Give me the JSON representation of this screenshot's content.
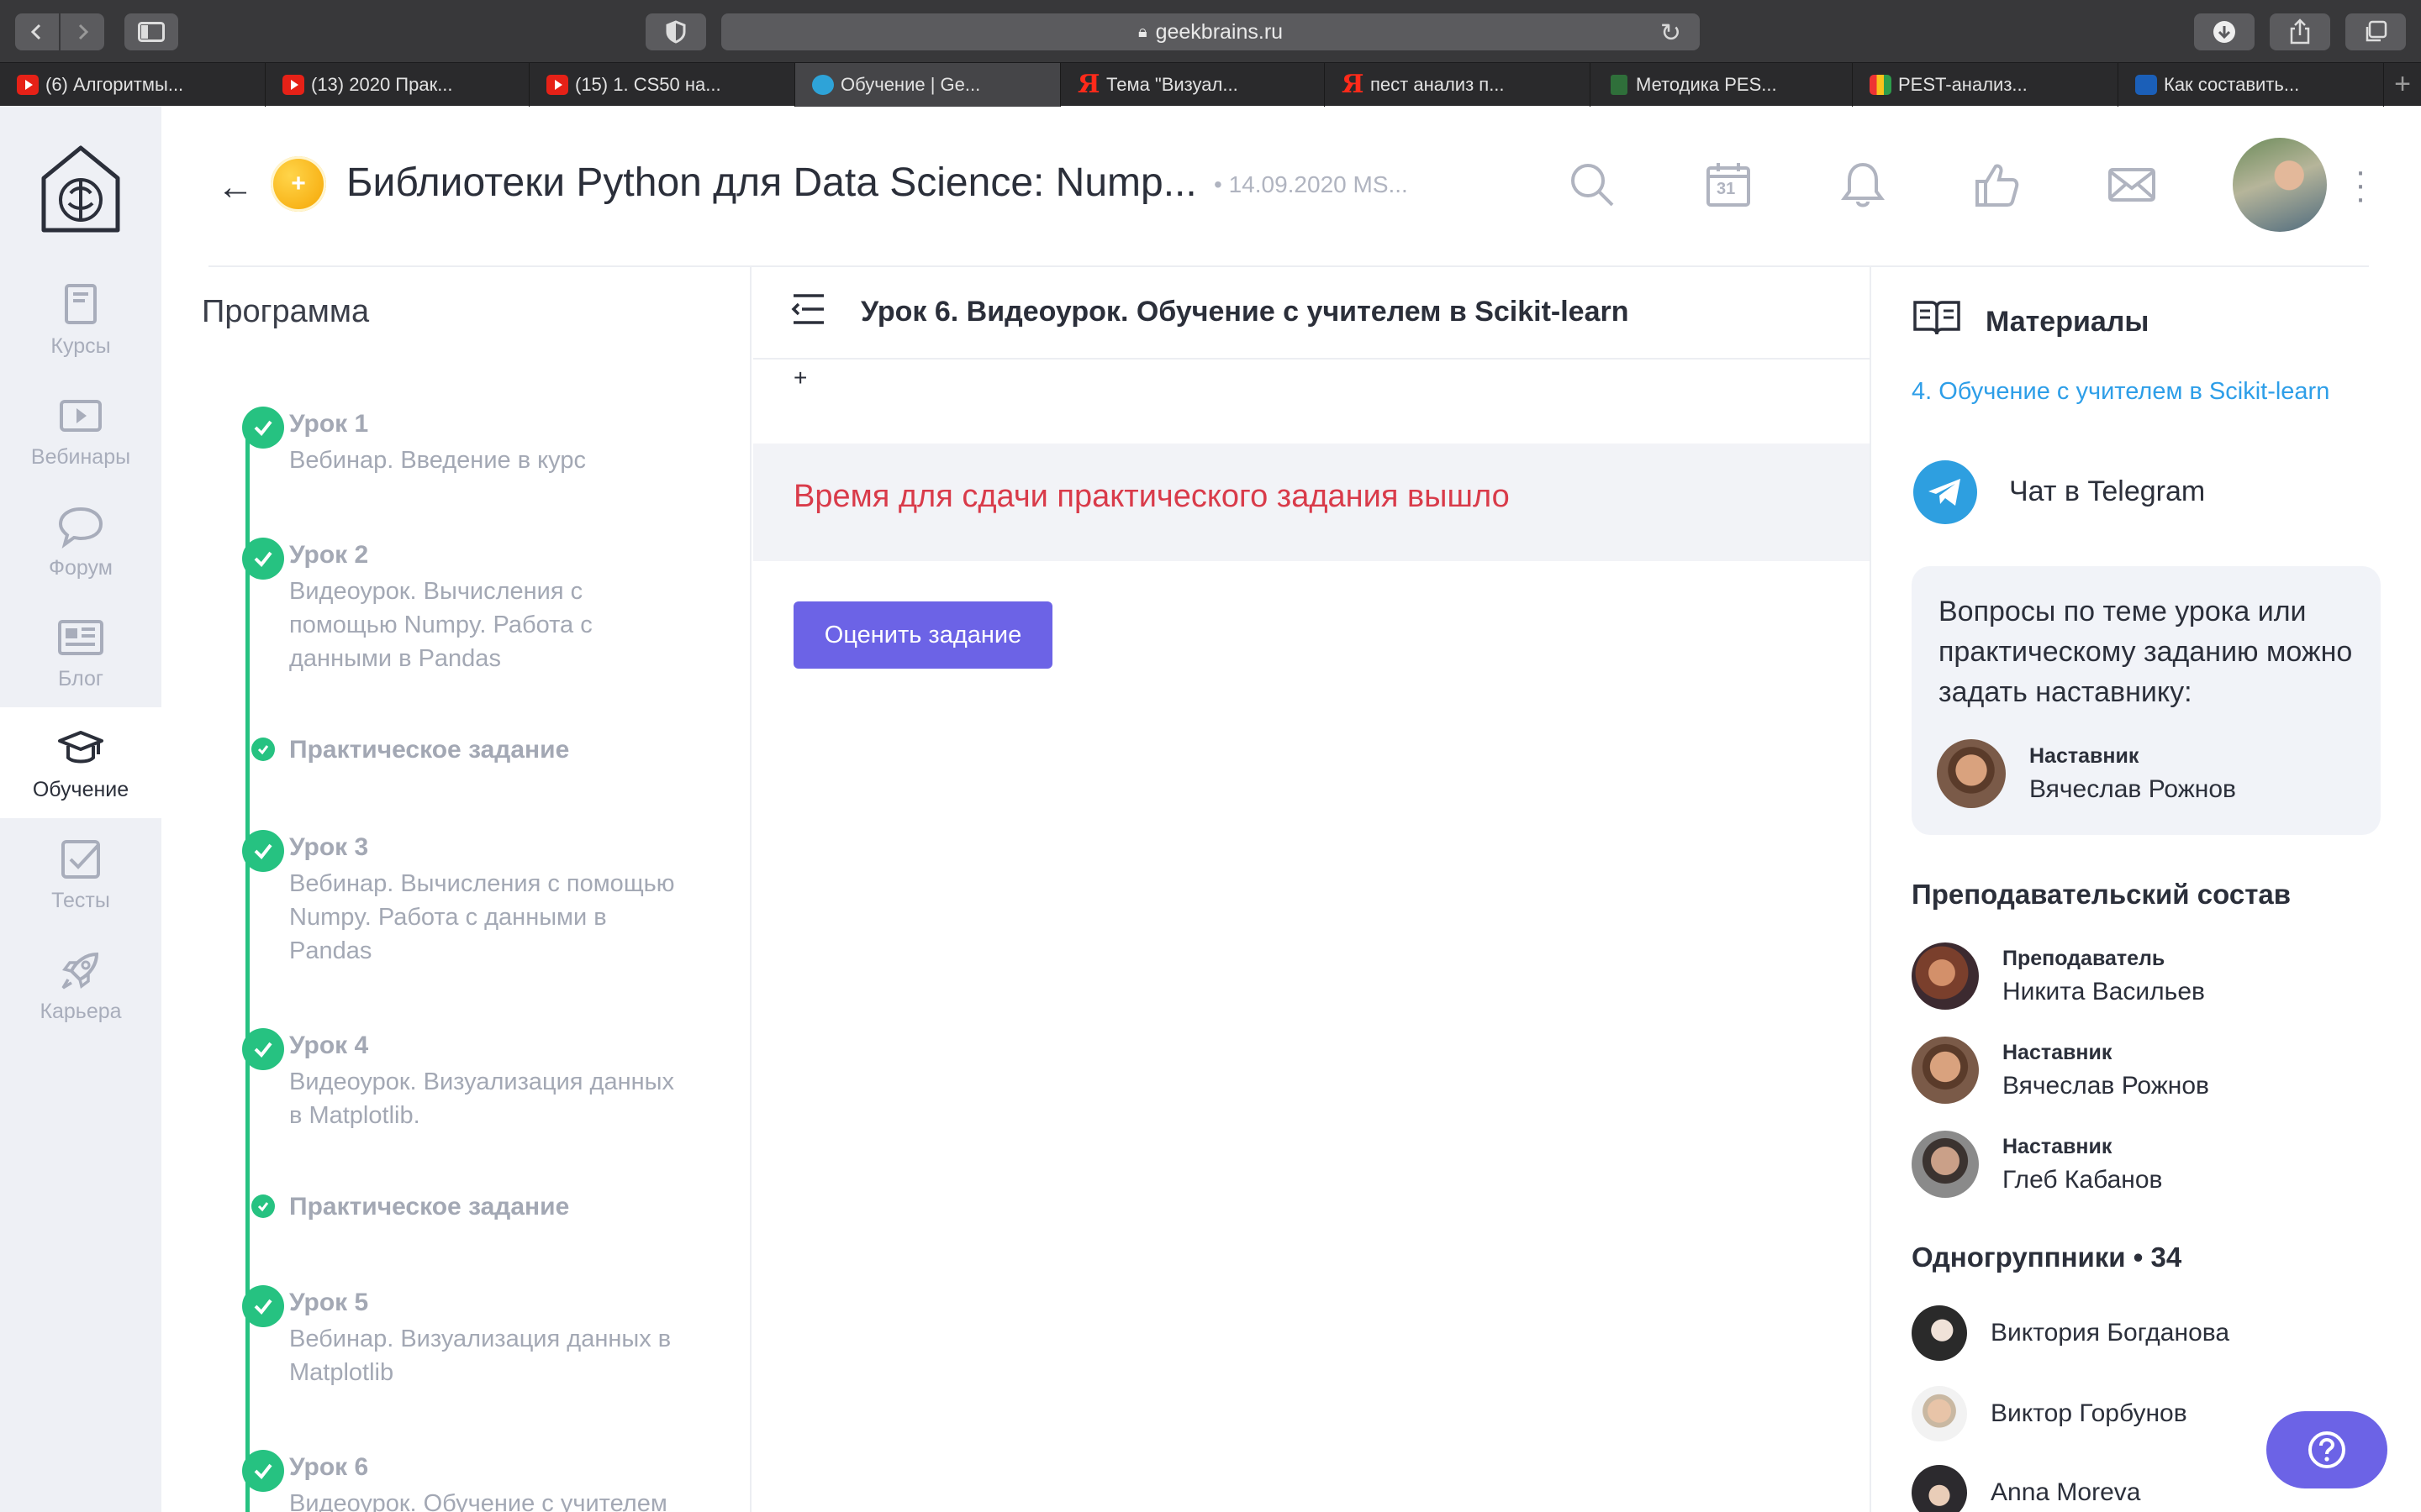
{
  "browser": {
    "url": "geekbrains.ru",
    "tabs": [
      {
        "favicon": "youtube-icon",
        "label": "(6) Алгоритмы..."
      },
      {
        "favicon": "youtube-icon",
        "label": "(13) 2020 Прак..."
      },
      {
        "favicon": "youtube-icon",
        "label": "(15) 1. CS50 на..."
      },
      {
        "favicon": "geekbrains-icon",
        "label": "Обучение | Ge..."
      },
      {
        "favicon": "yandex-icon",
        "label": "Тема \"Визуал..."
      },
      {
        "favicon": "yandex-icon",
        "label": "пест анализ п..."
      },
      {
        "favicon": "document-icon",
        "label": "Методика PES..."
      },
      {
        "favicon": "chart-icon",
        "label": "PEST-анализ..."
      },
      {
        "favicon": "article-icon",
        "label": "Как составить..."
      }
    ]
  },
  "nav": {
    "items": [
      {
        "label": "Курсы",
        "icon": "book-icon"
      },
      {
        "label": "Вебинары",
        "icon": "play-icon"
      },
      {
        "label": "Форум",
        "icon": "chat-icon"
      },
      {
        "label": "Блог",
        "icon": "newspaper-icon"
      },
      {
        "label": "Обучение",
        "icon": "graduation-cap-icon"
      },
      {
        "label": "Тесты",
        "icon": "checkbox-icon"
      },
      {
        "label": "Карьера",
        "icon": "rocket-icon"
      }
    ],
    "active": "Обучение"
  },
  "header": {
    "course_title": "Библиотеки Python для Data Science: Nump...",
    "date": "• 14.09.2020 MS...",
    "calendar_day": "31"
  },
  "program": {
    "title": "Программа",
    "lessons": [
      {
        "num": "Урок 1",
        "desc": "Вебинар. Введение в курс"
      },
      {
        "num": "Урок 2",
        "desc": "Видеоурок. Вычисления с помощью Numpy. Работа с данными в Pandas"
      },
      {
        "task": "Практическое задание"
      },
      {
        "num": "Урок 3",
        "desc": "Вебинар. Вычисления с помощью Numpy. Работа с данными в Pandas"
      },
      {
        "num": "Урок 4",
        "desc": "Видеоурок. Визуализация данных в Matplotlib."
      },
      {
        "task": "Практическое задание"
      },
      {
        "num": "Урок 5",
        "desc": "Вебинар. Визуализация данных в Matplotlib"
      },
      {
        "num": "Урок 6",
        "desc": "Видеоурок. Обучение с учителем"
      }
    ]
  },
  "main": {
    "lesson_title": "Урок 6. Видеоурок. Обучение с учителем в Scikit-learn",
    "plus": "+",
    "notice": "Время для сдачи практического задания вышло",
    "rate_button": "Оценить задание"
  },
  "sidebar": {
    "materials_title": "Материалы",
    "material_link": "4. Обучение с учителем в Scikit-learn",
    "telegram_label": "Чат в Telegram",
    "question_text": "Вопросы по теме урока или практическому заданию можно задать наставнику:",
    "mentor": {
      "role": "Наставник",
      "name": "Вячеслав Рожнов"
    },
    "staff_title": "Преподавательский состав",
    "staff": [
      {
        "role": "Преподаватель",
        "name": "Никита Васильев"
      },
      {
        "role": "Наставник",
        "name": "Вячеслав Рожнов"
      },
      {
        "role": "Наставник",
        "name": "Глеб Кабанов"
      }
    ],
    "groupmates_title": "Одногруппники • 34",
    "groupmates": [
      "Виктория Богданова",
      "Виктор Горбунов",
      "Anna Moreva"
    ]
  },
  "colors": {
    "accent": "#6c63e6",
    "success": "#26c281",
    "error": "#d93b4a",
    "link": "#2d9ee8"
  }
}
